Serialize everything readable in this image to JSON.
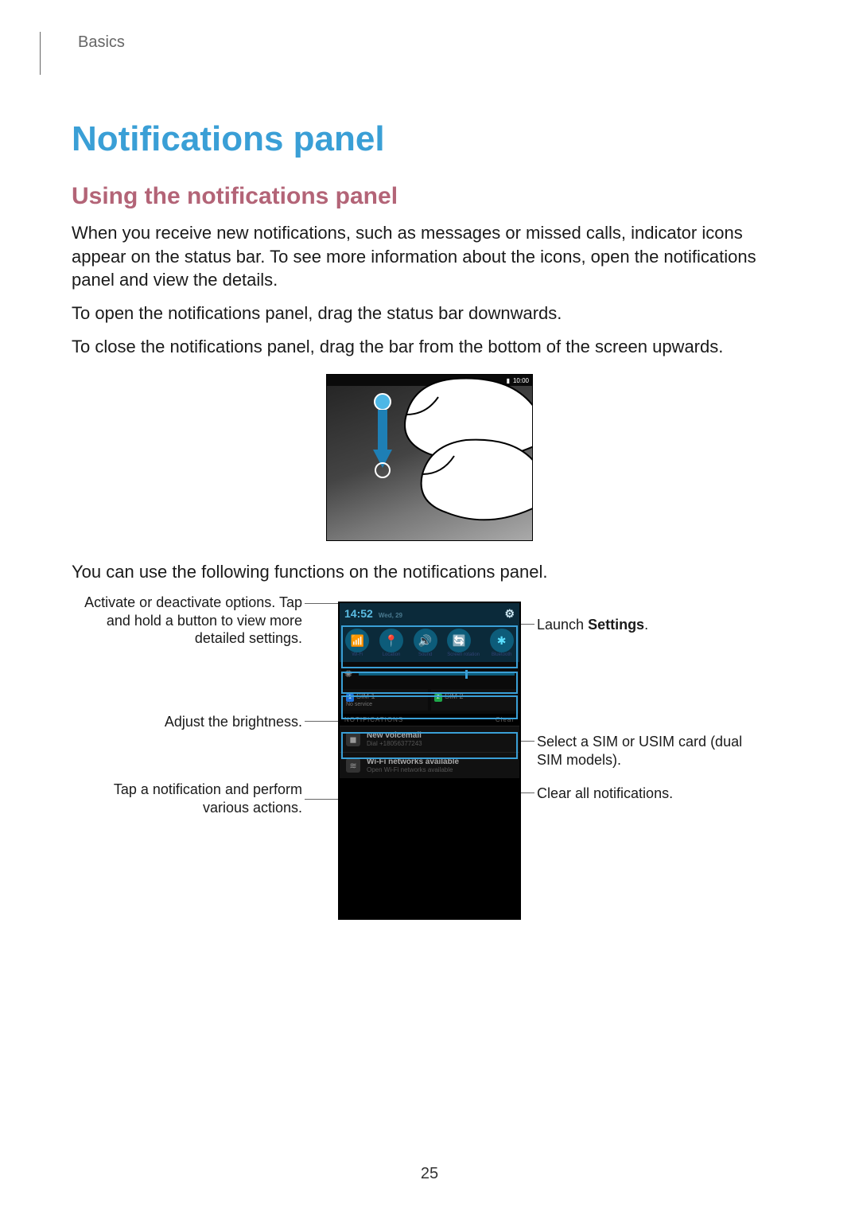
{
  "breadcrumb": "Basics",
  "title": "Notifications panel",
  "subtitle": "Using the notifications panel",
  "para1": "When you receive new notifications, such as messages or missed calls, indicator icons appear on the status bar. To see more information about the icons, open the notifications panel and view the details.",
  "para2": "To open the notifications panel, drag the status bar downwards.",
  "para3": "To close the notifications panel, drag the bar from the bottom of the screen upwards.",
  "para4": "You can use the following functions on the notifications panel.",
  "figure1": {
    "status_time": "10:00"
  },
  "callouts": {
    "left1": "Activate or deactivate options. Tap and hold a button to view more detailed settings.",
    "left2": "Adjust the brightness.",
    "left3": "Tap a notification and perform various actions.",
    "right1_prefix": "Launch ",
    "right1_bold": "Settings",
    "right1_suffix": ".",
    "right2": "Select a SIM or USIM card (dual SIM models).",
    "right3": "Clear all notifications."
  },
  "phone": {
    "time": "14:52",
    "date": "Wed, 29",
    "toggles": [
      "Wi-Fi",
      "Location",
      "Sound",
      "Screen rotation",
      "Bluetooth"
    ],
    "sim1": {
      "name": "SIM 1",
      "sub": "No service"
    },
    "sim2": {
      "name": "SIM 2",
      "sub": ""
    },
    "notif_header_left": "NOTIFICATIONS",
    "notif_header_right": "Clear",
    "n1_title": "New voicemail",
    "n1_sub": "Dial +18056377243",
    "n2_title": "Wi-Fi networks available",
    "n2_sub": "Open Wi-Fi networks available"
  },
  "page_number": "25"
}
